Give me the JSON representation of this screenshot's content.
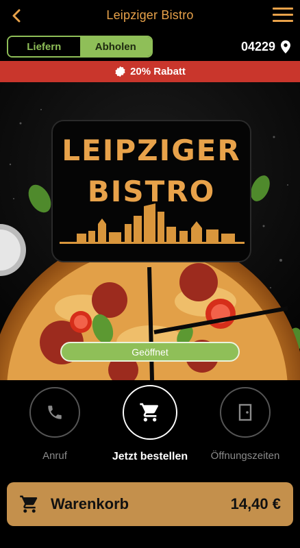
{
  "header": {
    "title": "Leipziger Bistro",
    "back_icon": "chevron-left-icon",
    "menu_icon": "hamburger-menu-icon",
    "accent_color": "#e8a24a"
  },
  "mode_toggle": {
    "options": [
      "Liefern",
      "Abholen"
    ],
    "selected": "Abholen",
    "color": "#8fbf58"
  },
  "location": {
    "zip": "04229",
    "icon": "map-pin-icon"
  },
  "discount_banner": {
    "text": "20% Rabatt",
    "icon": "badge-icon",
    "color": "#c9362c"
  },
  "hero": {
    "logo_line1": "LEIPZIGER",
    "logo_line2": "BISTRO",
    "status": "Geöffnet"
  },
  "actions": [
    {
      "label": "Anruf",
      "icon": "phone-icon"
    },
    {
      "label": "Jetzt bestellen",
      "icon": "cart-icon",
      "active": true
    },
    {
      "label": "Öffnungszeiten",
      "icon": "door-icon"
    }
  ],
  "cart": {
    "label": "Warenkorb",
    "total": "14,40 €",
    "icon": "cart-icon",
    "color": "#c4904c"
  }
}
